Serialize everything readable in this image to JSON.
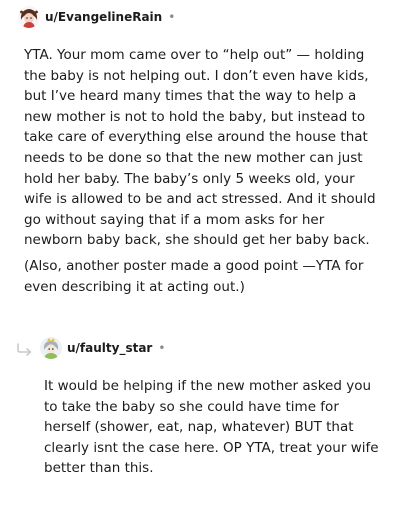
{
  "comments": [
    {
      "username": "u/EvangelineRain",
      "separator": "•",
      "avatar_icon": "user-avatar-icon",
      "paragraphs": [
        "YTA. Your mom came over to “help out” — holding the baby is not helping out. I don’t even have kids, but I’ve heard many times that the way to help a new mother is not to hold the baby, but instead to take care of everything else around the house that needs to be done so that the new mother can just hold her baby. The baby’s only 5 weeks old, your wife is allowed to be and act stressed. And it should go without saying that if a mom asks for her newborn baby back, she should get her baby back.",
        "(Also, another poster made a good point —YTA for even describing it at acting out.)"
      ]
    },
    {
      "username": "u/faulty_star",
      "separator": "•",
      "avatar_icon": "user-avatar-icon",
      "reply_icon": "reply-arrow-icon",
      "paragraphs": [
        "It would be helping if the new mother asked you to take the baby so she could have time for herself (shower, eat, nap, whatever) BUT that clearly isnt the case here. OP YTA, treat your wife better than this."
      ]
    }
  ],
  "colors": {
    "text": "#1c1c1c",
    "meta": "#878a8c",
    "reply_line": "#c7c9cc"
  }
}
